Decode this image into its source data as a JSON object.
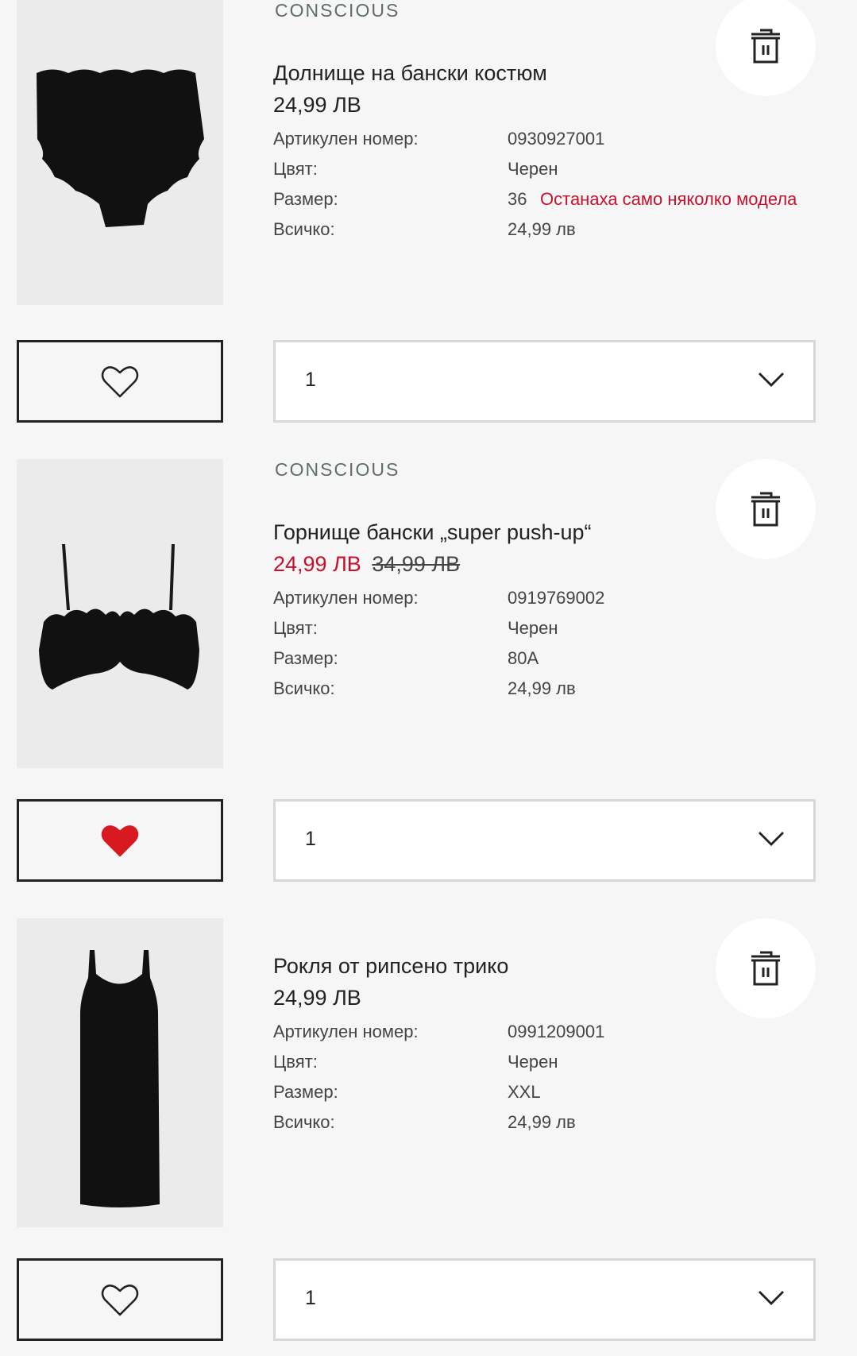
{
  "labels": {
    "article_number": "Артикулен номер:",
    "color": "Цвят:",
    "size": "Размер:",
    "total": "Всичко:"
  },
  "items": [
    {
      "brand": "CONSCIOUS",
      "title": "Долнище на бански костюм",
      "price": "24,99 ЛВ",
      "old_price": "",
      "article_number": "0930927001",
      "color": "Черен",
      "size": "36",
      "stock_warning": "Останаха само няколко модела",
      "total": "24,99 лв",
      "favorite": false,
      "quantity": "1",
      "image_icon": "bikini-bottom-image"
    },
    {
      "brand": "CONSCIOUS",
      "title": "Горнище бански „super push-up“",
      "price": "24,99 ЛВ",
      "old_price": "34,99 ЛВ",
      "article_number": "0919769002",
      "color": "Черен",
      "size": "80A",
      "stock_warning": "",
      "total": "24,99 лв",
      "favorite": true,
      "quantity": "1",
      "image_icon": "bikini-top-image"
    },
    {
      "brand": "",
      "title": "Рокля от рипсено трико",
      "price": "24,99 ЛВ",
      "old_price": "",
      "article_number": "0991209001",
      "color": "Черен",
      "size": "XXL",
      "stock_warning": "",
      "total": "24,99 лв",
      "favorite": false,
      "quantity": "1",
      "image_icon": "dress-image"
    }
  ],
  "colors": {
    "sale_red": "#c8102e",
    "heart_red": "#d71920",
    "brand_green": "#5e6e66",
    "text": "#222222",
    "background": "#f6f6f6"
  },
  "icons": [
    "trash-icon",
    "heart-icon",
    "chevron-down-icon"
  ]
}
